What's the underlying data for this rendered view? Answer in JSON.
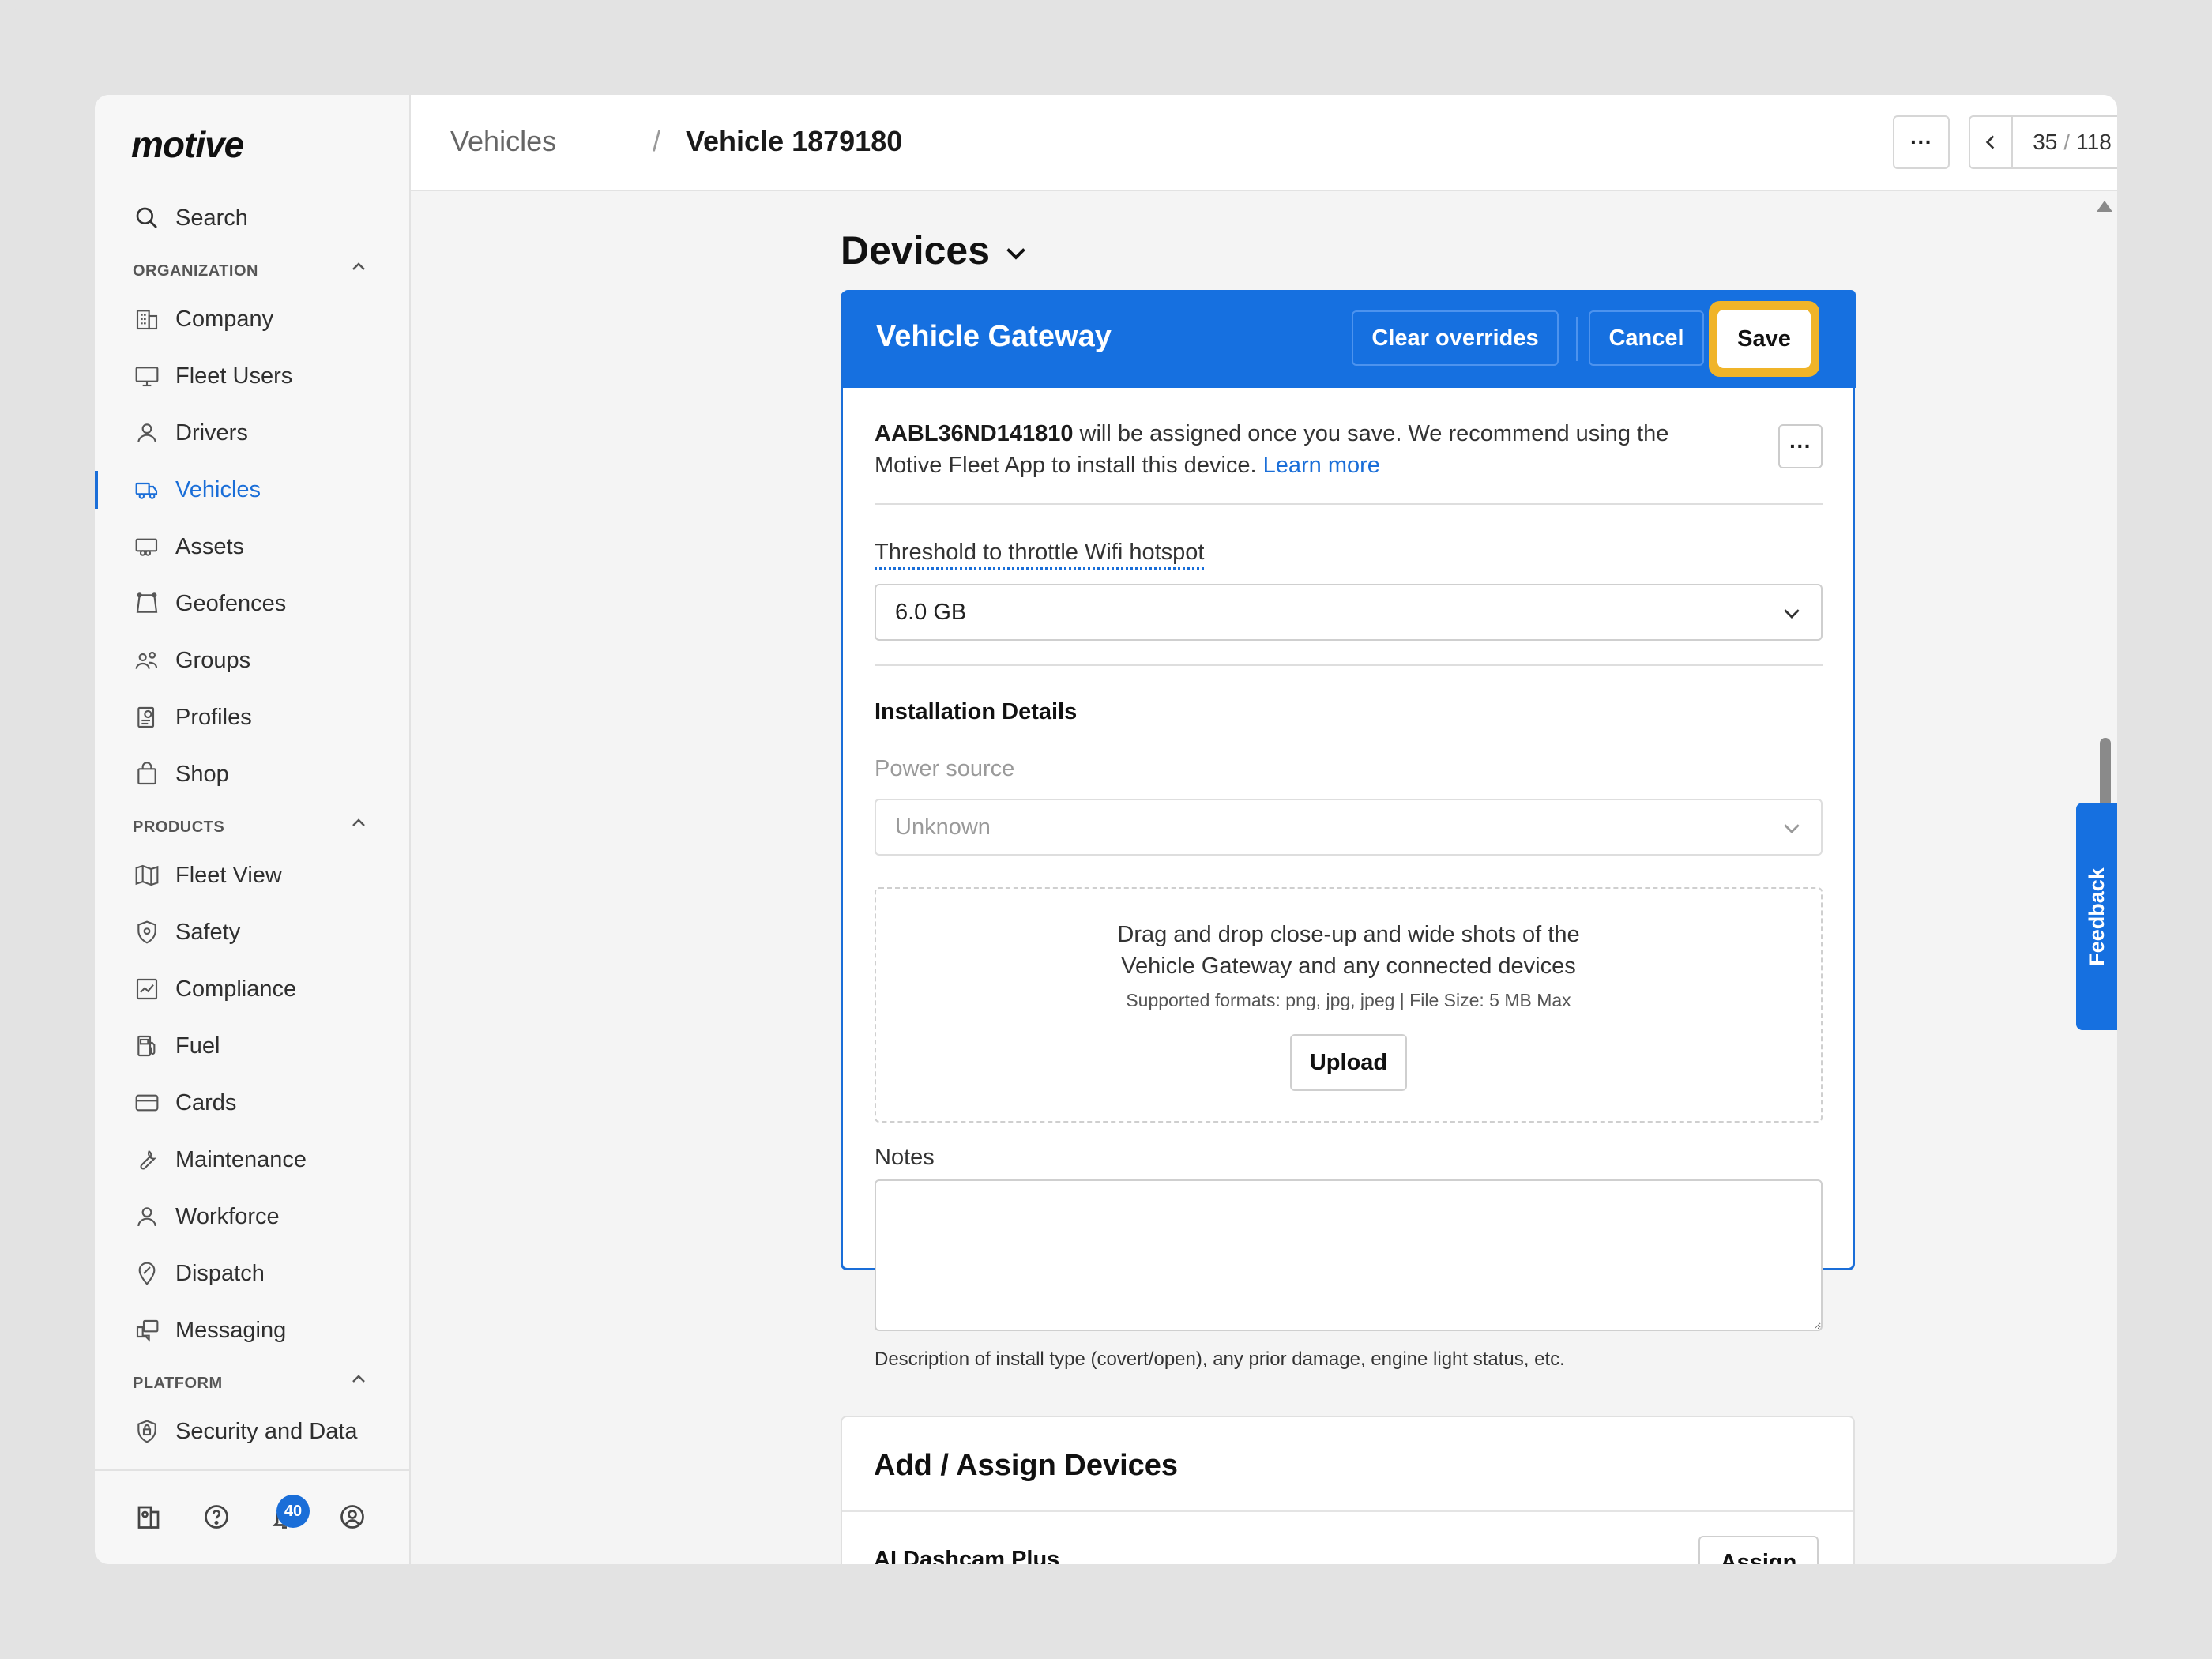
{
  "app": {
    "logo": "motive"
  },
  "sidebar": {
    "search_label": "Search",
    "sections": [
      {
        "label": "ORGANIZATION"
      },
      {
        "label": "PRODUCTS"
      },
      {
        "label": "PLATFORM"
      }
    ],
    "items": [
      {
        "label": "Company",
        "icon": "building-icon"
      },
      {
        "label": "Fleet Users",
        "icon": "monitor-icon"
      },
      {
        "label": "Drivers",
        "icon": "person-icon"
      },
      {
        "label": "Vehicles",
        "icon": "truck-icon",
        "active": true
      },
      {
        "label": "Assets",
        "icon": "trailer-icon"
      },
      {
        "label": "Geofences",
        "icon": "geofence-icon"
      },
      {
        "label": "Groups",
        "icon": "groups-icon"
      },
      {
        "label": "Profiles",
        "icon": "profile-gear-icon"
      },
      {
        "label": "Shop",
        "icon": "shopping-bag-icon"
      },
      {
        "label": "Fleet View",
        "icon": "map-icon"
      },
      {
        "label": "Safety",
        "icon": "shield-icon"
      },
      {
        "label": "Compliance",
        "icon": "compliance-icon"
      },
      {
        "label": "Fuel",
        "icon": "fuel-icon"
      },
      {
        "label": "Cards",
        "icon": "card-icon"
      },
      {
        "label": "Maintenance",
        "icon": "wrench-icon"
      },
      {
        "label": "Workforce",
        "icon": "person-icon"
      },
      {
        "label": "Dispatch",
        "icon": "dispatch-icon"
      },
      {
        "label": "Messaging",
        "icon": "messaging-icon"
      },
      {
        "label": "Security and Data",
        "icon": "lock-shield-icon"
      }
    ],
    "notification_count": "40"
  },
  "header": {
    "breadcrumb_parent": "Vehicles",
    "breadcrumb_sep": "/",
    "breadcrumb_current": "Vehicle 1879180",
    "more_label": "···",
    "pager_current": "35",
    "pager_sep": "/",
    "pager_total": "118"
  },
  "main": {
    "devices_title": "Devices",
    "gateway_card": {
      "title": "Vehicle Gateway",
      "clear_overrides_label": "Clear overrides",
      "cancel_label": "Cancel",
      "save_label": "Save",
      "serial": "AABL36ND141810",
      "assign_message": " will be assigned once you save. We recommend using the Motive Fleet App to install this device. ",
      "learn_more": "Learn more",
      "more_label": "···",
      "threshold_label": "Threshold to throttle Wifi hotspot",
      "threshold_value": "6.0 GB",
      "installation_heading": "Installation Details",
      "power_source_label": "Power source",
      "power_source_value": "Unknown",
      "dropzone_line1": "Drag and drop close-up and wide shots of the",
      "dropzone_line2": "Vehicle Gateway and any connected devices",
      "dropzone_formats": "Supported formats: png, jpg, jpeg | File Size: 5 MB Max",
      "upload_label": "Upload",
      "notes_label": "Notes",
      "notes_value": "",
      "notes_hint": "Description of install type (covert/open), any prior damage, engine light status, etc."
    },
    "assign_card": {
      "title": "Add / Assign Devices",
      "first_item": "AI Dashcam Plus",
      "assign_label": "Assign"
    },
    "feedback_label": "Feedback"
  },
  "colors": {
    "accent": "#1670e0",
    "highlight": "#f0b429",
    "link": "#1a6ed8"
  }
}
